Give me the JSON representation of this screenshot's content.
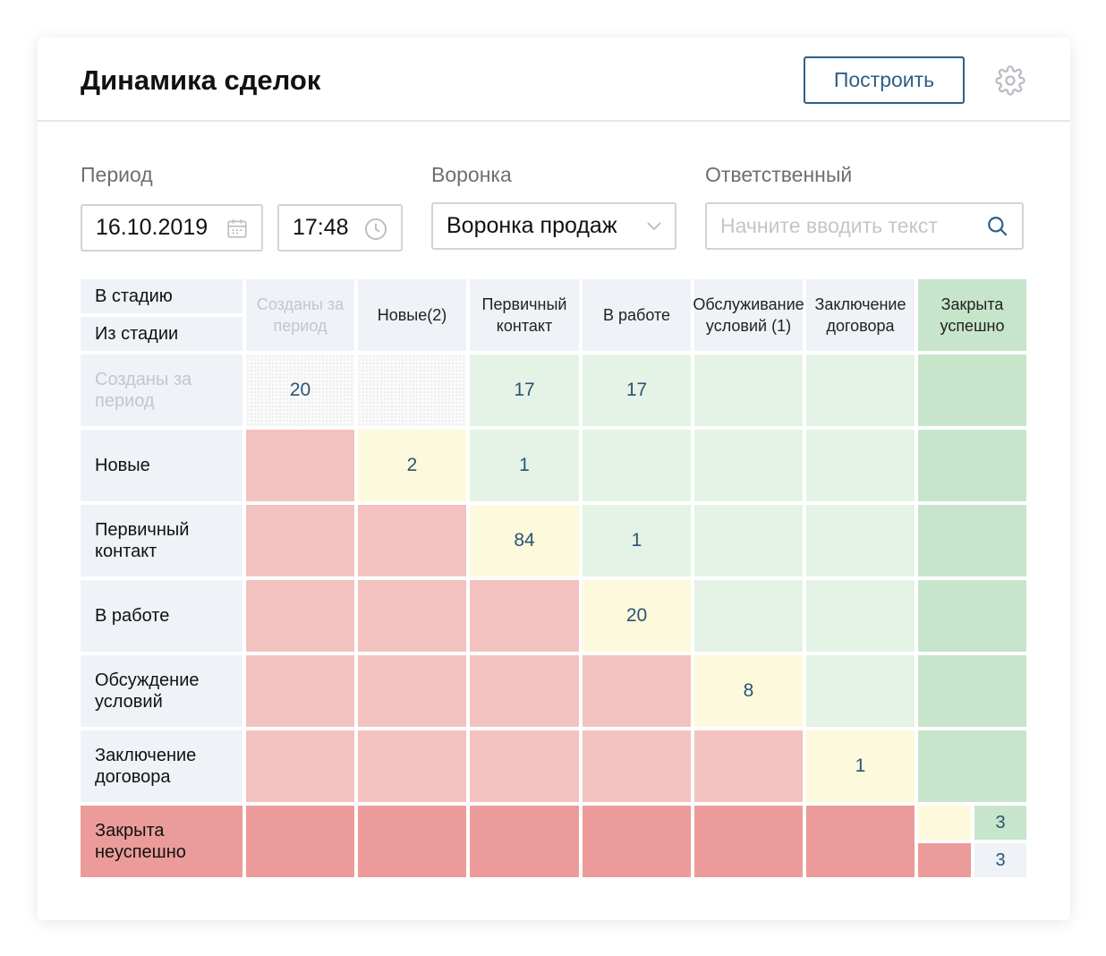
{
  "header": {
    "title": "Динамика сделок",
    "build_button": "Построить"
  },
  "filters": {
    "period_label": "Период",
    "date_value": "16.10.2019",
    "time_value": "17:48",
    "funnel_label": "Воронка",
    "funnel_value": "Воронка продаж",
    "responsible_label": "Ответственный",
    "responsible_placeholder": "Начните вводить текст"
  },
  "table": {
    "corner_to": "В стадию",
    "corner_from": "Из стадии",
    "columns": [
      "Созданы за период",
      "Новые(2)",
      "Первичный контакт",
      "В работе",
      "Обслуживание условий (1)",
      "Заключение договора",
      "Закрыта успешно"
    ],
    "rows": [
      {
        "label": "Созданы за период",
        "values": [
          "20",
          "",
          "17",
          "17",
          "",
          "",
          ""
        ]
      },
      {
        "label": "Новые",
        "values": [
          "",
          "2",
          "1",
          "",
          "",
          "",
          ""
        ]
      },
      {
        "label": "Первичный контакт",
        "values": [
          "",
          "",
          "84",
          "1",
          "",
          "",
          ""
        ]
      },
      {
        "label": "В работе",
        "values": [
          "",
          "",
          "",
          "20",
          "",
          "",
          ""
        ]
      },
      {
        "label": "Обсуждение условий",
        "values": [
          "",
          "",
          "",
          "",
          "8",
          "",
          ""
        ]
      },
      {
        "label": "Заключение договора",
        "values": [
          "",
          "",
          "",
          "",
          "",
          "1",
          ""
        ]
      },
      {
        "label": "Закрыта неуспешно",
        "values": [
          "",
          "",
          "",
          "",
          "",
          "",
          ""
        ],
        "split_values": [
          "3",
          "3"
        ]
      }
    ]
  },
  "colors": {
    "accent": "#2e5f86",
    "light_green": "#e4f3e5",
    "dark_green": "#c7e5cb",
    "light_red": "#f3c2c0",
    "dark_red": "#eb9c9a",
    "light_yellow": "#fdf9dc",
    "header_bg": "#eff2f6"
  },
  "icons": {
    "settings": "gear-icon",
    "calendar": "calendar-icon",
    "clock": "clock-icon",
    "dropdown": "chevron-down-icon",
    "search": "search-icon"
  }
}
